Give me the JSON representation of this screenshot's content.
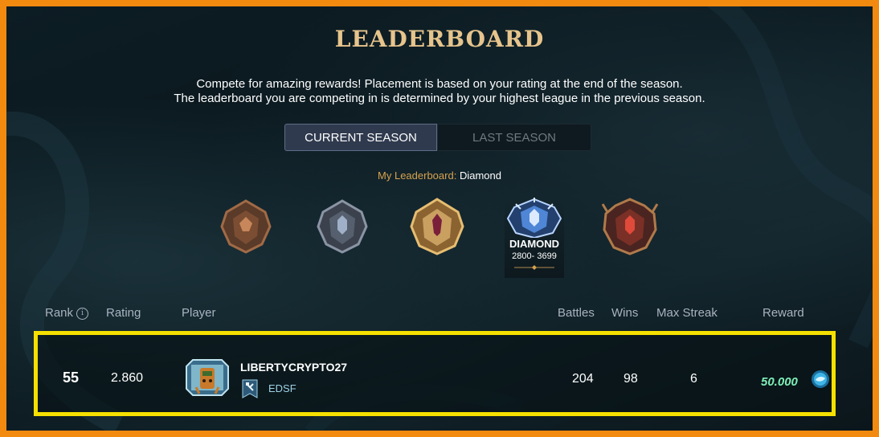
{
  "header": {
    "title": "LEADERBOARD",
    "description_line1": "Compete for amazing rewards! Placement is based on your rating at the end of the season.",
    "description_line2": "The leaderboard you are competing in is determined by your highest league in the previous season."
  },
  "season_tabs": {
    "current": "CURRENT SEASON",
    "last": "LAST SEASON",
    "selected": "current"
  },
  "my_leaderboard": {
    "label": "My Leaderboard:",
    "value": "Diamond"
  },
  "leagues": [
    {
      "id": "bronze",
      "icon": "bronze-league-icon",
      "color": "#8a5a3a"
    },
    {
      "id": "silver",
      "icon": "silver-league-icon",
      "color": "#6f7a8a"
    },
    {
      "id": "gold",
      "icon": "gold-league-icon",
      "color": "#c99a4e"
    },
    {
      "id": "diamond",
      "icon": "diamond-league-icon",
      "color": "#5d8fd6",
      "name": "DIAMOND",
      "range": "2800- 3699",
      "selected": true
    },
    {
      "id": "champion",
      "icon": "champion-league-icon",
      "color": "#9a3a2e"
    }
  ],
  "columns": {
    "rank": "Rank",
    "rating": "Rating",
    "player": "Player",
    "battles": "Battles",
    "wins": "Wins",
    "max_streak": "Max Streak",
    "reward": "Reward"
  },
  "row": {
    "rank": "55",
    "rating": "2.860",
    "player": "LIBERTYCRYPTO27",
    "guild": "EDSF",
    "battles": "204",
    "wins": "98",
    "max_streak": "6",
    "reward": "50.000",
    "reward_icon": "sps-token-icon"
  },
  "colors": {
    "frame": "#f28a10",
    "highlight": "#f5e000",
    "title": "#e6c48c",
    "reward": "#7ff0b8"
  }
}
